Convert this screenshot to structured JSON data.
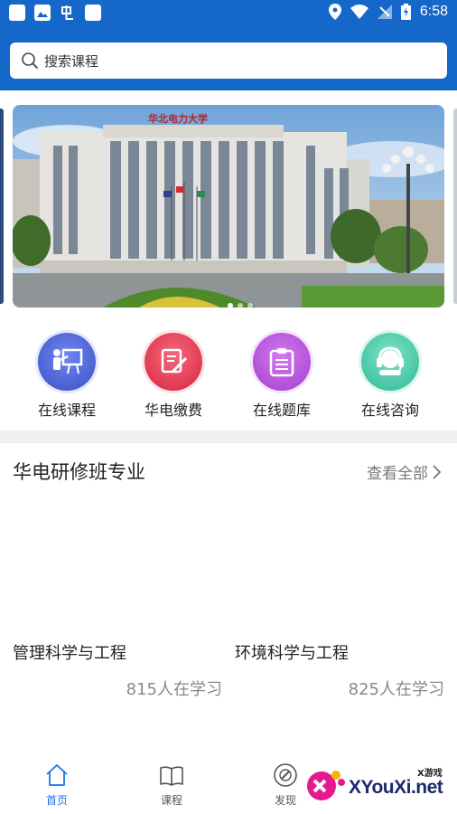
{
  "status_bar": {
    "time": "6:58"
  },
  "search": {
    "placeholder": "搜索课程"
  },
  "banner": {
    "sign_text": "华北电力大学",
    "slide_count": 3,
    "active_slide": 1
  },
  "quick_nav": [
    {
      "label": "在线课程",
      "icon": "teacher-board-icon",
      "color": "#4a64d8"
    },
    {
      "label": "华电缴费",
      "icon": "bill-pen-icon",
      "color": "#e8384f"
    },
    {
      "label": "在线题库",
      "icon": "clipboard-icon",
      "color": "#b44fd8"
    },
    {
      "label": "在线咨询",
      "icon": "headset-icon",
      "color": "#3cc7a6"
    }
  ],
  "section": {
    "title": "华电研修班专业",
    "more_label": "查看全部"
  },
  "courses": [
    {
      "name": "管理科学与工程",
      "count": "815人在学习"
    },
    {
      "name": "环境科学与工程",
      "count": "825人在学习"
    }
  ],
  "bottom_nav": [
    {
      "label": "首页",
      "icon": "home-icon",
      "active": true
    },
    {
      "label": "课程",
      "icon": "book-icon",
      "active": false
    },
    {
      "label": "发现",
      "icon": "compass-icon",
      "active": false
    }
  ],
  "watermark": {
    "text": "XYouXi.net",
    "small": "X游戏"
  },
  "colors": {
    "brand_blue": "#1568c9",
    "active_tab": "#1a73e8"
  }
}
